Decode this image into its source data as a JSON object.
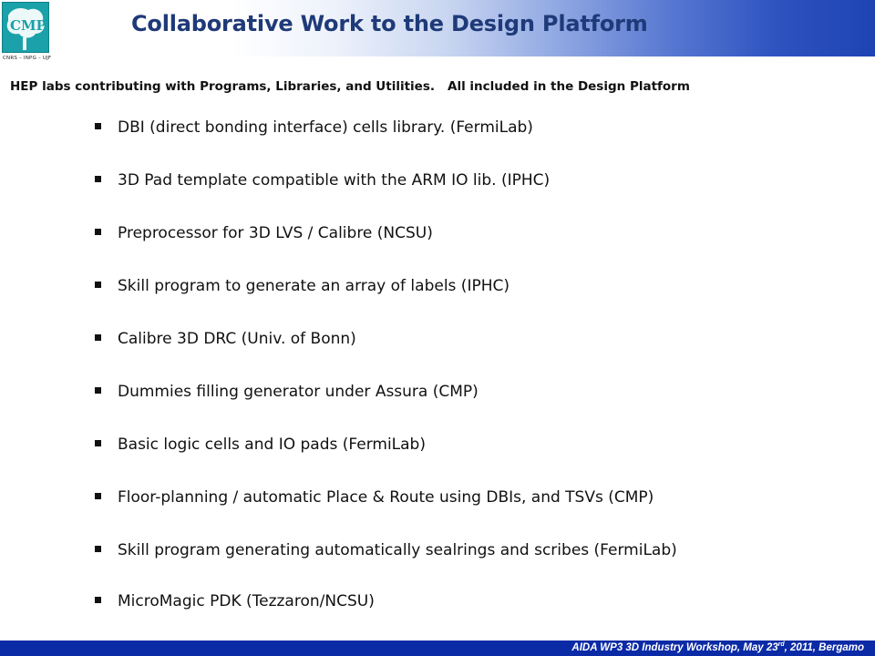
{
  "header": {
    "title": "Collaborative Work to the Design Platform",
    "logo_text": "CMP",
    "logo_subtext": "CNRS – INPG – UJF"
  },
  "subtitle": {
    "part1": "HEP labs contributing with Programs, Libraries, and Utilities.",
    "part2": "All included in the Design Platform"
  },
  "bullets": [
    "DBI (direct bonding interface) cells library. (FermiLab)",
    "3D Pad template compatible with the ARM IO lib. (IPHC)",
    "Preprocessor for 3D LVS / Calibre (NCSU)",
    "Skill program to generate an array of labels (IPHC)",
    "Calibre 3D DRC (Univ. of Bonn)",
    "Dummies filling generator under Assura (CMP)",
    "Basic logic cells and IO pads (FermiLab)",
    "Floor-planning / automatic Place & Route using DBIs, and TSVs (CMP)",
    "Skill program generating automatically sealrings and scribes (FermiLab)",
    "MicroMagic PDK (Tezzaron/NCSU)"
  ],
  "footer": {
    "text_before_sup": "AIDA WP3 3D Industry Workshop, May 23",
    "sup": "rd",
    "text_after_sup": ", 2011, Bergamo"
  },
  "colors": {
    "title": "#1f3a78",
    "logo_bg": "#1aa1a9",
    "footer_bg": "#0b2aa6",
    "gradient_end": "#1e43b3"
  }
}
